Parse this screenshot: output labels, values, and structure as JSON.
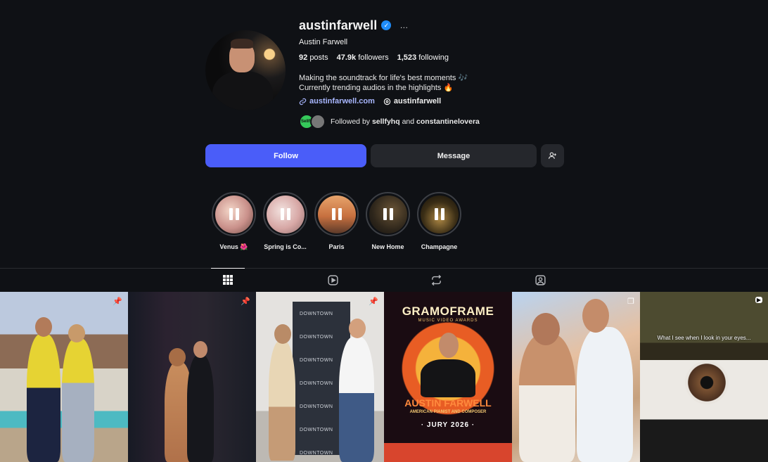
{
  "profile": {
    "username": "austinfarwell",
    "full_name": "Austin Farwell",
    "more_icon": "…",
    "stats": {
      "posts": "92",
      "posts_label": "posts",
      "followers": "47.9k",
      "followers_label": "followers",
      "following": "1,523",
      "following_label": "following"
    },
    "bio_line1": "Making the soundtrack for life's best moments 🎶",
    "bio_line2": "Currently trending audios in the highlights 🔥",
    "website": "austinfarwell.com",
    "threads_handle": "austinfarwell",
    "followed_by_prefix": "Followed by",
    "followed_by_user1": "sellfyhq",
    "followed_by_and": "and",
    "followed_by_user2": "constantinelovera",
    "follower_avatar1_text": "Sellfy"
  },
  "actions": {
    "follow_label": "Follow",
    "message_label": "Message"
  },
  "highlights": [
    {
      "label": "Venus 🌺",
      "color": "#c9908a"
    },
    {
      "label": "Spring is Co...",
      "color": "#d7a7a5"
    },
    {
      "label": "Paris",
      "color": "#c7703f"
    },
    {
      "label": "New Home",
      "color": "#2e261b"
    },
    {
      "label": "Champagne",
      "color": "#3b2e16"
    }
  ],
  "tabs": [
    "grid-icon",
    "reels-icon",
    "reposts-icon",
    "tagged-icon"
  ],
  "posts": {
    "t3_banner_text": "DOWNTOWN",
    "t4_brand": "GRAMOFRAME",
    "t4_sub": "MUSIC VIDEO AWARDS",
    "t4_name": "AUSTIN FARWELL",
    "t4_tag": "AMERICAN PIANIST AND COMPOSER",
    "t4_jury": "· JURY 2026 ·",
    "t6_caption": "What I see when I look in your eyes..."
  },
  "colors": {
    "follow_button": "#4a5df9",
    "verified": "#1f8cf9",
    "link": "#a9b7ff",
    "background": "#0f1115"
  }
}
